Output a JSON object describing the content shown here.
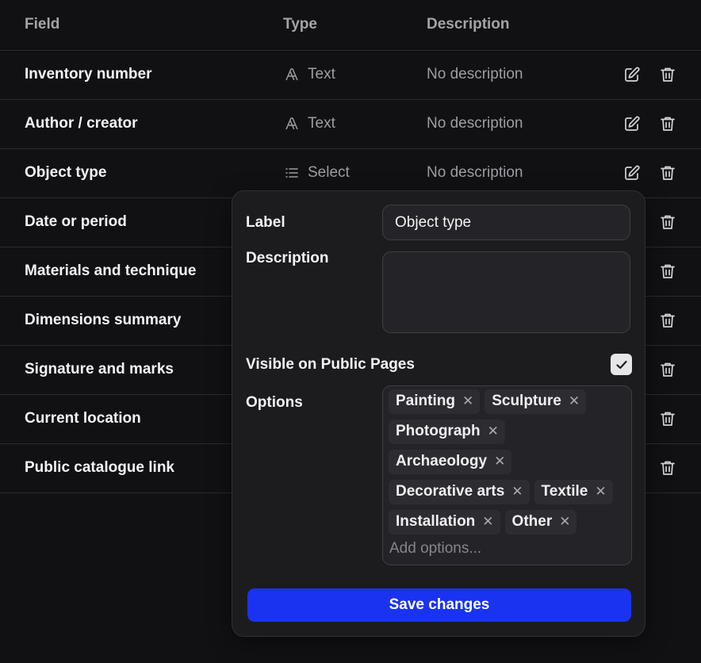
{
  "table": {
    "headers": {
      "field": "Field",
      "type": "Type",
      "description": "Description"
    },
    "rows": [
      {
        "field": "Inventory number",
        "type": "Text",
        "type_icon": "text-type-icon",
        "description": "No description"
      },
      {
        "field": "Author / creator",
        "type": "Text",
        "type_icon": "text-type-icon",
        "description": "No description"
      },
      {
        "field": "Object type",
        "type": "Select",
        "type_icon": "list-icon",
        "description": "No description"
      },
      {
        "field": "Date or period"
      },
      {
        "field": "Materials and technique"
      },
      {
        "field": "Dimensions summary"
      },
      {
        "field": "Signature and marks"
      },
      {
        "field": "Current location"
      },
      {
        "field": "Public catalogue link"
      }
    ],
    "row_actions": {
      "edit_icon": "edit-icon",
      "delete_icon": "trash-icon"
    }
  },
  "popover": {
    "label_title": "Label",
    "label_value": "Object type",
    "description_title": "Description",
    "description_value": "",
    "visible_title": "Visible on Public Pages",
    "visible_checked": true,
    "options_title": "Options",
    "options": [
      "Painting",
      "Sculpture",
      "Photograph",
      "Archaeology",
      "Decorative arts",
      "Textile",
      "Installation",
      "Other"
    ],
    "add_placeholder": "Add options...",
    "save_label": "Save changes"
  },
  "colors": {
    "background": "#111113",
    "popover": "#1c1c1f",
    "accent": "#1a33f0"
  }
}
